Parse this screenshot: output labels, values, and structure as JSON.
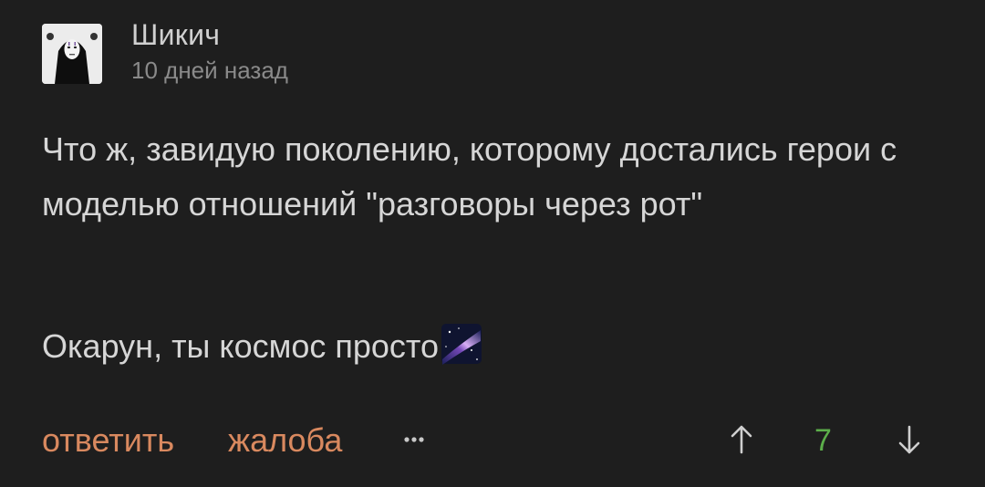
{
  "comment": {
    "author": "Шикич",
    "timestamp": "10 дней назад",
    "avatar_icon": "no-face-avatar",
    "paragraph_1": "Что ж, завидую поколению, которому достались герои с моделью отношений \"разговоры через рот\"",
    "paragraph_2": "Окарун, ты космос просто",
    "paragraph_2_emoji": "milky-way-emoji"
  },
  "actions": {
    "reply_label": "ответить",
    "report_label": "жалоба",
    "more_icon": "more-dots-icon"
  },
  "votes": {
    "score": "7",
    "up_icon": "arrow-up-icon",
    "down_icon": "arrow-down-icon",
    "score_color": "#5cae4a"
  },
  "colors": {
    "background": "#1e1e1e",
    "text": "#d6d6d6",
    "muted": "#8a8a8a",
    "accent_action": "#d9895f"
  }
}
